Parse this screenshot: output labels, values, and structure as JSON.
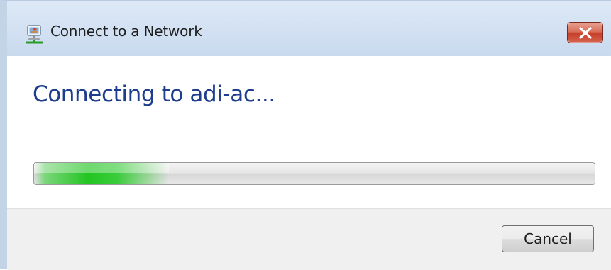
{
  "window": {
    "title": "Connect to a Network",
    "title_icon": "network-icon",
    "close_icon": "close-icon"
  },
  "main": {
    "heading": "Connecting to adi-ac...",
    "progress": {
      "state": "indeterminate",
      "accent_color": "#22c522"
    }
  },
  "footer": {
    "cancel_label": "Cancel"
  },
  "colors": {
    "heading": "#1e3d8c",
    "close_button": "#c7402a",
    "titlebar": "#d4e2f3",
    "footer": "#f0f0f0"
  }
}
